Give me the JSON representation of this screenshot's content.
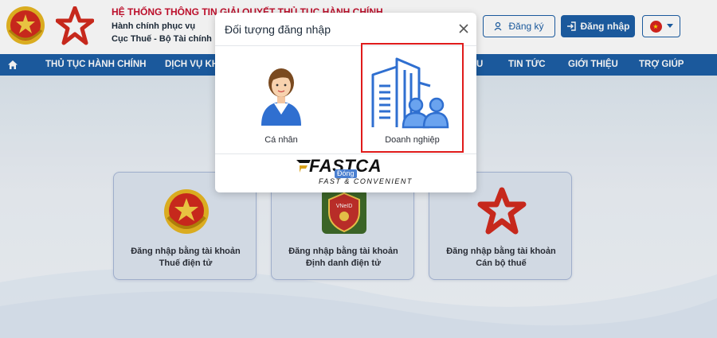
{
  "header": {
    "title": "HỆ THỐNG THÔNG TIN GIẢI QUYẾT THỦ TỤC HÀNH CHÍNH",
    "subtitle1": "Hành chính phục vụ",
    "subtitle2": "Cục Thuế - Bộ Tài chính",
    "register_label": "Đăng ký",
    "login_label": "Đăng nhập",
    "language": "vi"
  },
  "nav": {
    "items": [
      "THỦ TỤC HÀNH CHÍNH",
      "DỊCH VỤ KH",
      "U",
      "TIN TỨC",
      "GIỚI THIỆU",
      "TRỢ GIÚP"
    ]
  },
  "cards": [
    {
      "line1": "Đăng nhập bằng tài khoản",
      "line2": "Thuế điện tử"
    },
    {
      "line1": "Đăng nhập bằng tài khoản",
      "line2": "Định danh điện tử"
    },
    {
      "line1": "Đăng nhập bằng tài khoản",
      "line2": "Cán bộ thuế"
    }
  ],
  "modal": {
    "title": "Đối tượng đăng nhập",
    "options": [
      {
        "label": "Cá nhân"
      },
      {
        "label": "Doanh nghiệp"
      }
    ],
    "close_label": "Đóng"
  },
  "watermark": {
    "name": "FASTCA",
    "tagline": "FAST & CONVENIENT"
  },
  "colors": {
    "primary": "#1d5fa6",
    "title_red": "#c8102e",
    "selection_border": "#e01b1b"
  }
}
